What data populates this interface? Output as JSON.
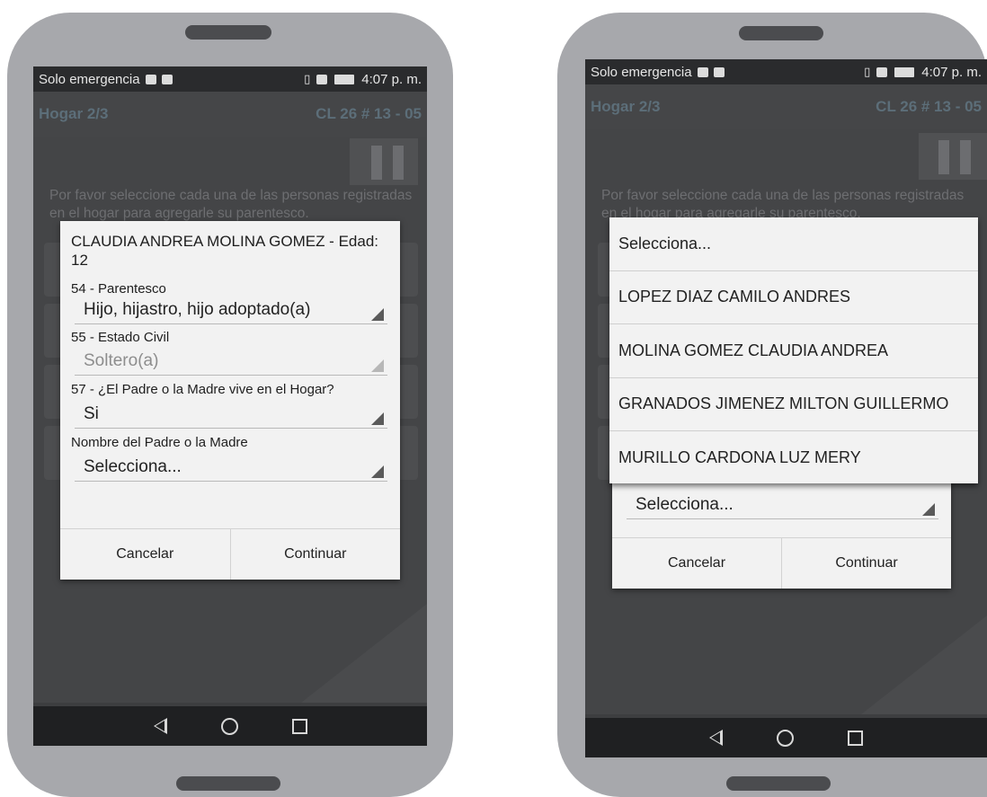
{
  "status": {
    "carrier": "Solo emergencia",
    "time": "4:07 p. m."
  },
  "appbar": {
    "title": "Hogar 2/3",
    "address_left": "CL 26 # 13 - 05",
    "address_right": "CL 26 # 13 - 05"
  },
  "instructions": "Por favor seleccione cada una de las personas registradas en el hogar para agregarle su parentesco.",
  "dialog": {
    "title": "CLAUDIA ANDREA MOLINA GOMEZ - Edad: 12",
    "q54_label": "54 - Parentesco",
    "q54_value": "Hijo, hijastro, hijo adoptado(a)",
    "q55_label": "55 - Estado Civil",
    "q55_value": "Soltero(a)",
    "q57_label": "57 - ¿El Padre o la Madre vive en el Hogar?",
    "q57_value": "Si",
    "parent_label": "Nombre del Padre o la Madre",
    "parent_value": "Selecciona...",
    "cancel": "Cancelar",
    "continue": "Continuar"
  },
  "dropdown": {
    "items": [
      "Selecciona...",
      "LOPEZ DIAZ CAMILO ANDRES",
      "MOLINA GOMEZ CLAUDIA ANDREA",
      "GRANADOS JIMENEZ MILTON GUILLERMO",
      "MURILLO CARDONA LUZ MERY"
    ]
  },
  "icons": [
    "back-icon",
    "home-icon",
    "recents-icon",
    "pause-icon",
    "vibrate-icon",
    "battery-icon"
  ],
  "colors": {
    "phone_shell": "#a7a8ac",
    "screen_bg": "#3d3e40",
    "dialog_bg": "#f2f2f2"
  }
}
